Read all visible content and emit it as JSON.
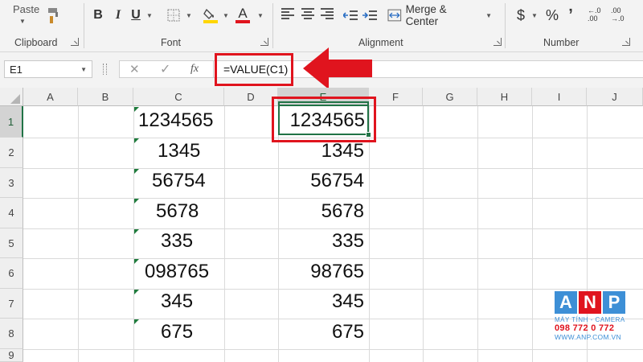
{
  "ribbon": {
    "paste_label": "Paste",
    "clipboard_label": "Clipboard",
    "font_label": "Font",
    "alignment_label": "Alignment",
    "number_label": "Number",
    "bold_label": "B",
    "italic_label": "I",
    "underline_label": "U",
    "font_color_label": "A",
    "merge_label": "Merge & Center",
    "currency_label": "$",
    "percent_label": "%",
    "comma_label": "ʼ",
    "inc_decimal_label": "←.0\n.00",
    "dec_decimal_label": ".00\n→.0",
    "accent_red": "#e0141e",
    "fill_yellow": "#ffd600"
  },
  "formula_bar": {
    "name_box": "E1",
    "cancel_glyph": "✕",
    "enter_glyph": "✓",
    "fx_glyph": "fx",
    "formula": "=VALUE(C1)"
  },
  "grid": {
    "columns": [
      "A",
      "B",
      "C",
      "D",
      "E",
      "F",
      "G",
      "H",
      "I",
      "J"
    ],
    "rows": [
      "1",
      "2",
      "3",
      "4",
      "5",
      "6",
      "7",
      "8",
      "9"
    ],
    "column_c": [
      "1234565",
      "1345",
      "56754",
      "5678",
      "335",
      "098765",
      "345",
      "675"
    ],
    "column_e": [
      "1234565",
      "1345",
      "56754",
      "5678",
      "335",
      "98765",
      "345",
      "675"
    ],
    "selected_cell": "E1",
    "selection_color": "#217346",
    "error_indicator_color": "#1e7b3c"
  },
  "watermark": {
    "letters": [
      "A",
      "N",
      "P"
    ],
    "letter_colors": [
      "#3d8fd6",
      "#e0141e",
      "#3d8fd6"
    ],
    "tagline": "MÁY TÍNH - CAMERA",
    "phone": "098 772 0 772",
    "website": "WWW.ANP.COM.VN"
  }
}
